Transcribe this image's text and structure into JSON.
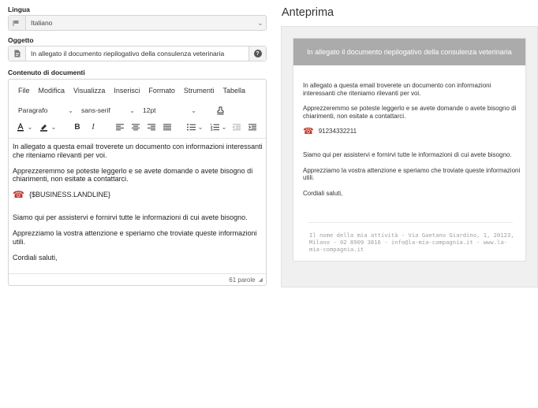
{
  "language": {
    "label": "Lingua",
    "value": "Italiano"
  },
  "subject": {
    "label": "Oggetto",
    "value": "In allegato il documento riepilogativo della consulenza veterinaria"
  },
  "content": {
    "label": "Contenuto di documenti",
    "menu": [
      "File",
      "Modifica",
      "Visualizza",
      "Inserisci",
      "Formato",
      "Strumenti",
      "Tabella"
    ],
    "block_format": "Paragrafo",
    "font_family": "sans-serif",
    "font_size": "12pt",
    "paragraphs": {
      "p1": "In allegato a questa email troverete un documento con informazioni interessanti che riteniamo rilevanti per voi.",
      "p2": "Apprezzeremmo se poteste leggerlo e se avete domande o avete bisogno di chiarimenti, non esitate a contattarci.",
      "phone": "{$BUSINESS.LANDLINE}",
      "p3": "Siamo qui per assistervi e fornirvi tutte le informazioni di cui avete bisogno.",
      "p4": "Apprezziamo la vostra attenzione e speriamo che troviate queste informazioni utili.",
      "p5": "Cordiali saluti,"
    },
    "word_count": "61 parole"
  },
  "preview": {
    "title": "Anteprima",
    "header": "In allegato il documento riepilogativo della consulenza veterinaria",
    "p1": "In allegato a questa email troverete un documento con informazioni interessanti che riteniamo rilevanti per voi.",
    "p2": "Apprezzeremmo se poteste leggerlo e se avete domande o avete bisogno di chiarimenti, non esitate a contattarci.",
    "phone": "91234332211",
    "p3": "Siamo qui per assistervi e fornirvi tutte le informazioni di cui avete bisogno.",
    "p4": "Apprezziamo la vostra attenzione e speriamo che troviate queste informazioni utili.",
    "p5": "Cordiali saluti,",
    "footer": "Il nome della mia attività - Via Gaetano Giardino, 1, 20123, Milano - 02 8909 3816 - info@la-mia-compagnia.it - www.la-mia-compagnia.it"
  },
  "colors": {
    "phone_icon": "#c0392b",
    "preview_header_bg": "#ababab"
  }
}
